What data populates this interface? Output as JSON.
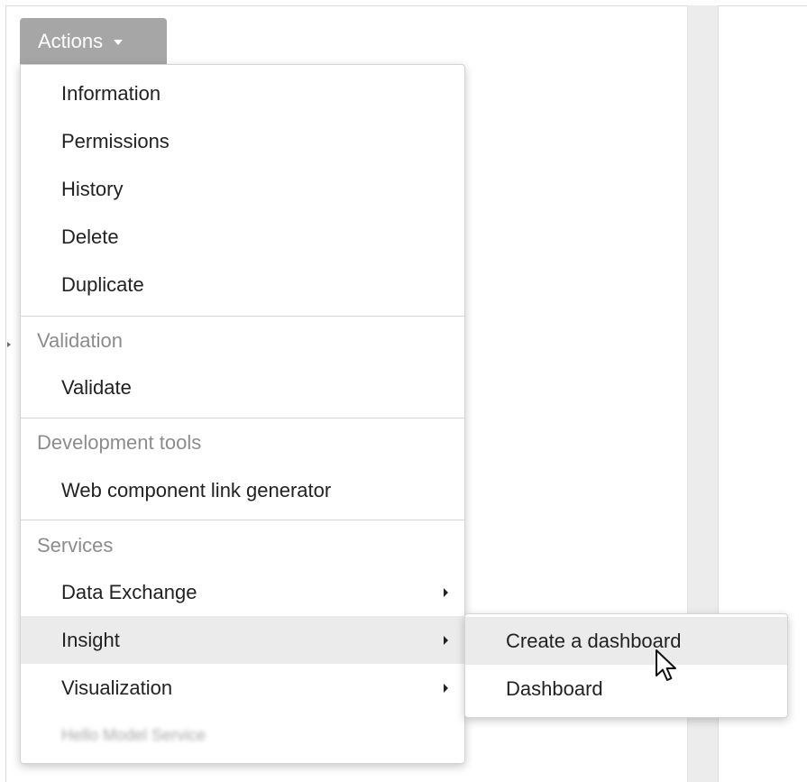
{
  "actions_button": {
    "label": "Actions",
    "icon": "caret-down-icon"
  },
  "menu": {
    "general_items": [
      {
        "label": "Information"
      },
      {
        "label": "Permissions"
      },
      {
        "label": "History"
      },
      {
        "label": "Delete"
      },
      {
        "label": "Duplicate"
      }
    ],
    "validation": {
      "header": "Validation",
      "item": "Validate"
    },
    "dev_tools": {
      "header": "Development tools",
      "item": "Web component link generator"
    },
    "services": {
      "header": "Services",
      "items": [
        {
          "label": "Data Exchange",
          "has_submenu": true
        },
        {
          "label": "Insight",
          "has_submenu": true,
          "highlighted": true
        },
        {
          "label": "Visualization",
          "has_submenu": true
        }
      ],
      "blurred_item": "Hello Model Service"
    }
  },
  "insight_submenu": {
    "items": [
      {
        "label": "Create a dashboard",
        "highlighted": true
      },
      {
        "label": "Dashboard"
      }
    ]
  },
  "colors": {
    "button_bg": "#a6a6a6",
    "highlight_bg": "#ebebeb",
    "header_text": "#8c8c8c",
    "item_text": "#222222",
    "side_strip": "#ececec"
  }
}
